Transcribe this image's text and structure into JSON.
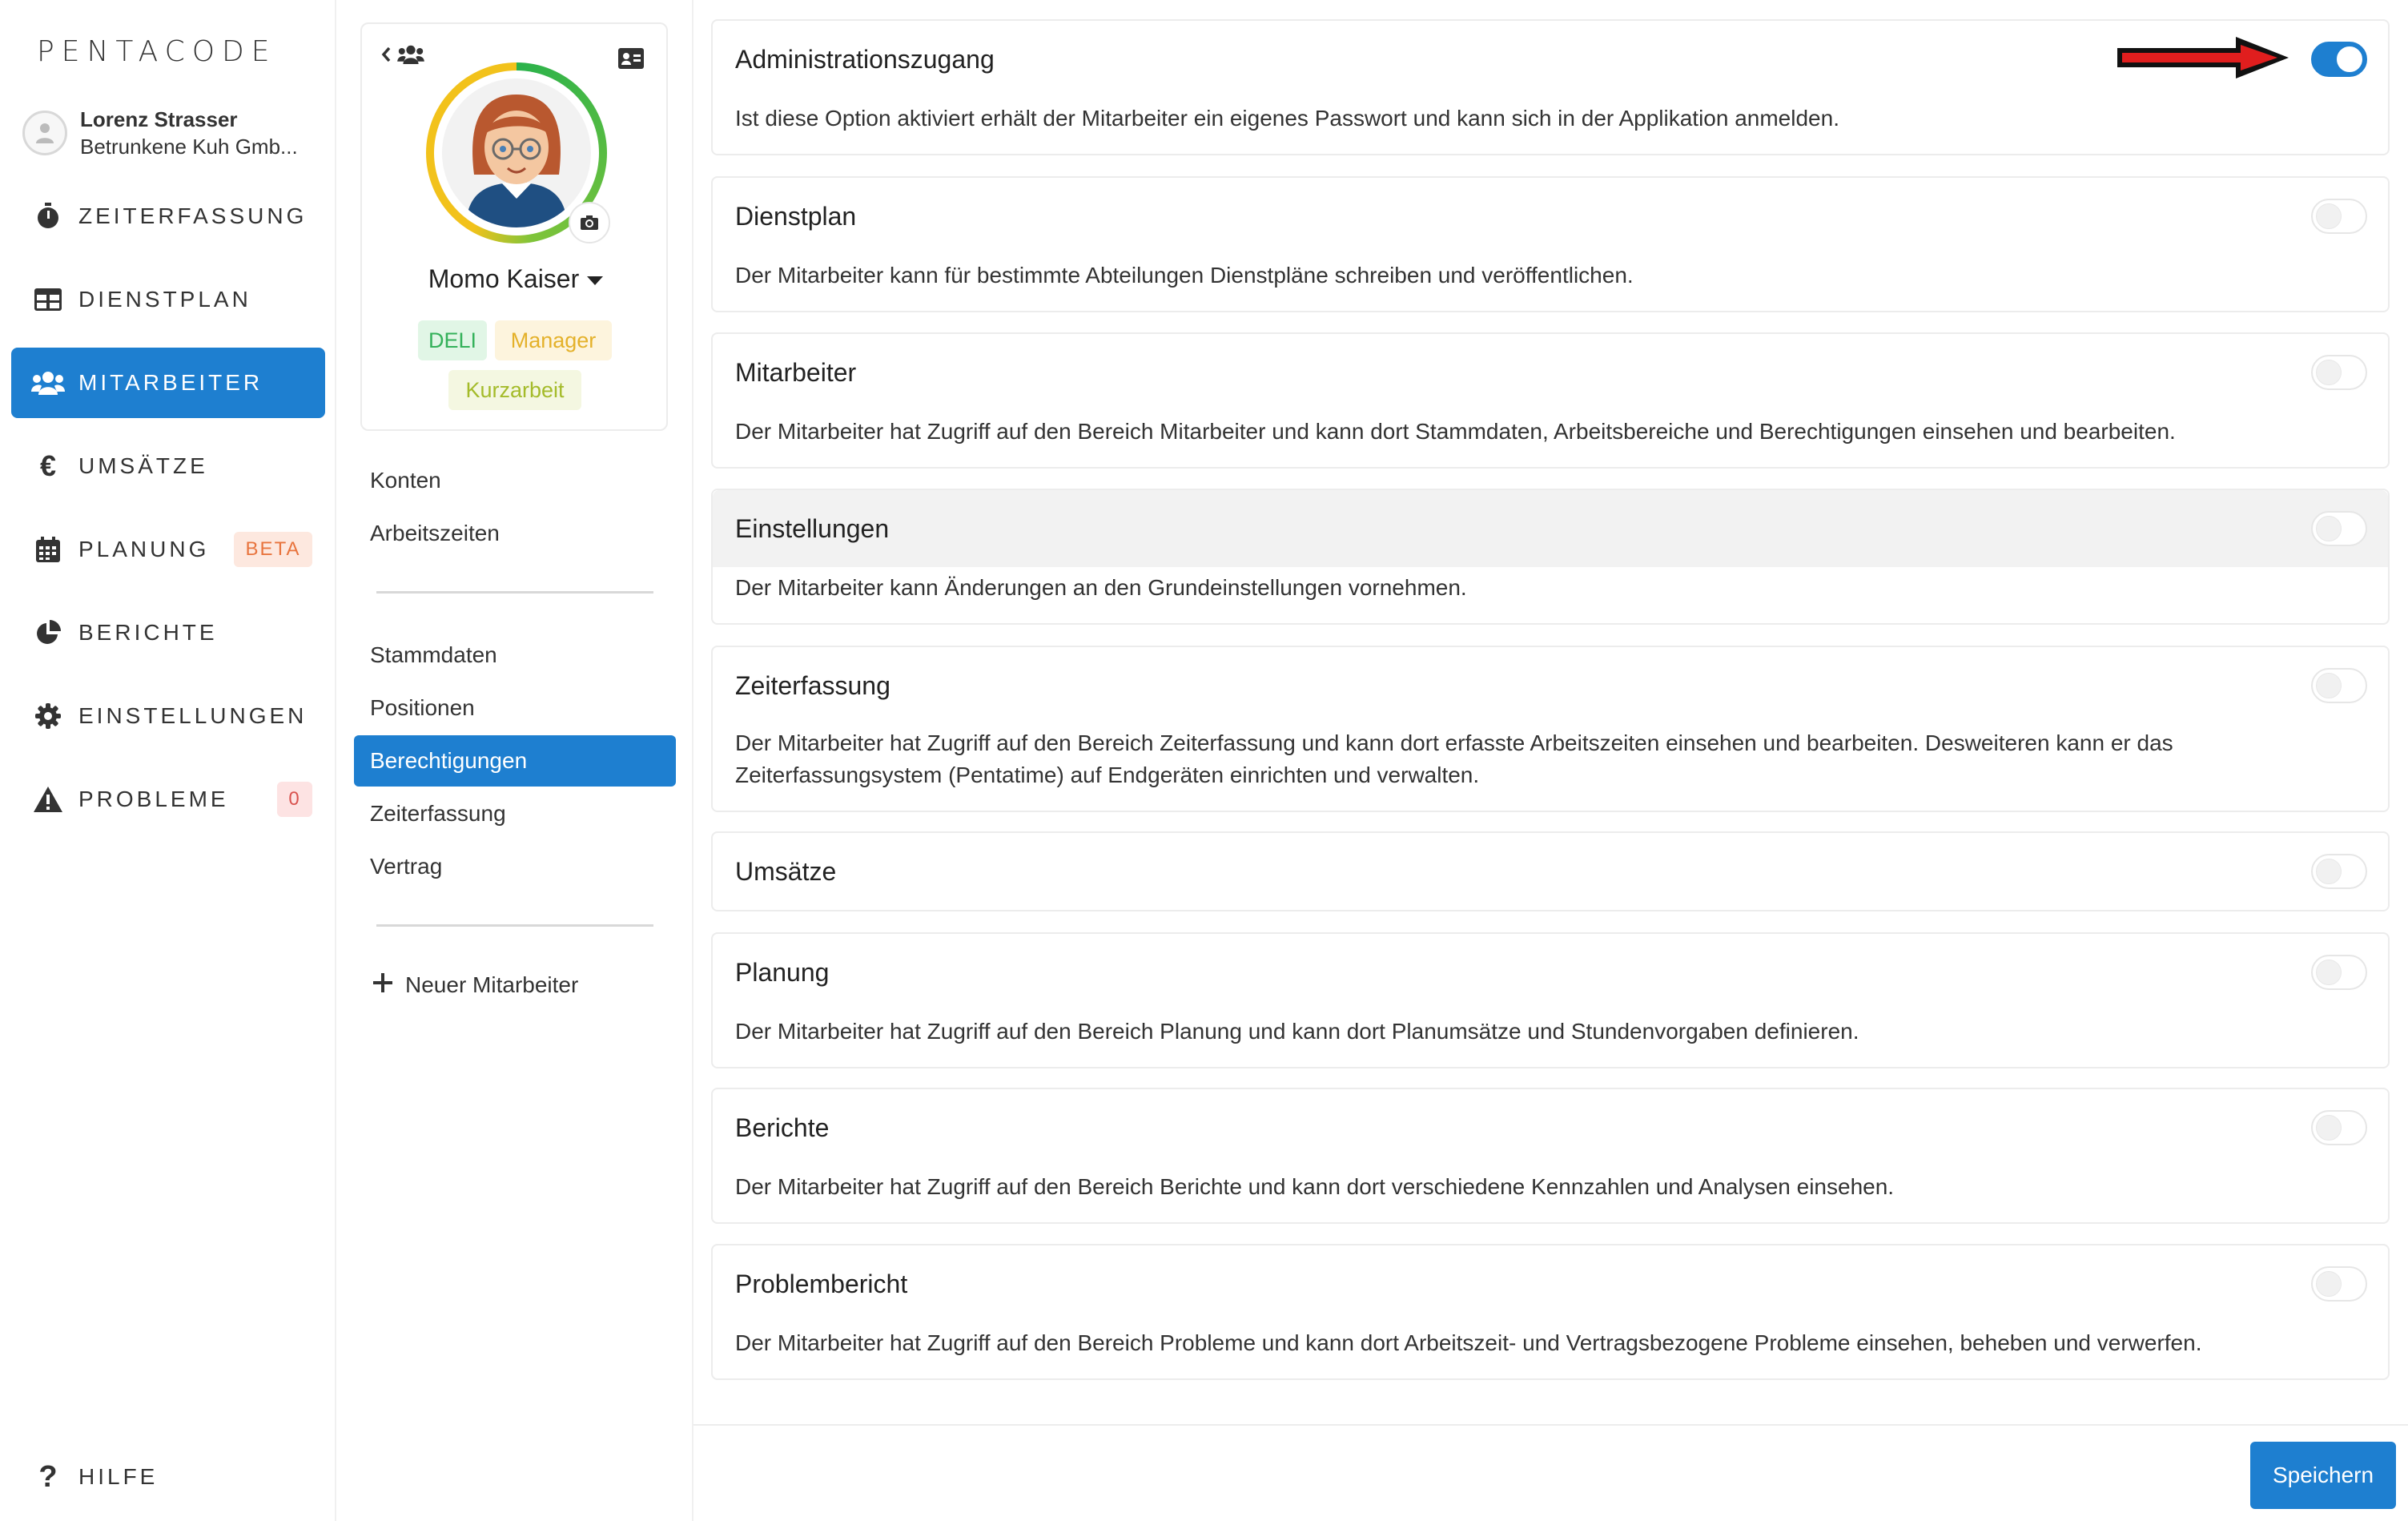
{
  "app": {
    "logo": "PENTACODE"
  },
  "user": {
    "name": "Lorenz Strasser",
    "company": "Betrunkene Kuh Gmb..."
  },
  "nav": {
    "items": [
      {
        "label": "ZEITERFASSUNG",
        "icon": "stopwatch-icon"
      },
      {
        "label": "DIENSTPLAN",
        "icon": "table-icon"
      },
      {
        "label": "MITARBEITER",
        "icon": "users-icon",
        "active": true
      },
      {
        "label": "UMSÄTZE",
        "icon": "euro-icon"
      },
      {
        "label": "PLANUNG",
        "icon": "calendar-icon",
        "badge": "BETA"
      },
      {
        "label": "BERICHTE",
        "icon": "pie-chart-icon"
      },
      {
        "label": "EINSTELLUNGEN",
        "icon": "gear-icon"
      },
      {
        "label": "PROBLEME",
        "icon": "warning-icon",
        "badge": "0"
      }
    ],
    "help": "HILFE"
  },
  "employee": {
    "name": "Momo Kaiser",
    "tags": [
      "DELI",
      "Manager",
      "Kurzarbeit"
    ]
  },
  "subnav": {
    "group1": [
      "Konten",
      "Arbeitszeiten"
    ],
    "group2": [
      "Stammdaten",
      "Positionen",
      "Berechtigungen",
      "Zeiterfassung",
      "Vertrag"
    ],
    "active": "Berechtigungen",
    "new_employee": "Neuer Mitarbeiter"
  },
  "permissions": [
    {
      "title": "Administrationszugang",
      "desc": "Ist diese Option aktiviert erhält der Mitarbeiter ein eigenes Passwort und kann sich in der Applikation anmelden.",
      "enabled": true
    },
    {
      "title": "Dienstplan",
      "desc": "Der Mitarbeiter kann für bestimmte Abteilungen Dienstpläne schreiben und veröffentlichen.",
      "enabled": false
    },
    {
      "title": "Mitarbeiter",
      "desc": "Der Mitarbeiter hat Zugriff auf den Bereich Mitarbeiter und kann dort Stammdaten, Arbeitsbereiche und Berechtigungen einsehen und bearbeiten.",
      "enabled": false
    },
    {
      "title": "Einstellungen",
      "desc": "Der Mitarbeiter kann Änderungen an den Grundeinstellungen vornehmen.",
      "enabled": false
    },
    {
      "title": "Zeiterfassung",
      "desc": "Der Mitarbeiter hat Zugriff auf den Bereich Zeiterfassung und kann dort erfasste Arbeitszeiten einsehen und bearbeiten. Desweiteren kann er das Zeiterfassungsystem (Pentatime) auf Endgeräten einrichten und verwalten.",
      "enabled": false
    },
    {
      "title": "Umsätze",
      "desc": "",
      "enabled": false
    },
    {
      "title": "Planung",
      "desc": "Der Mitarbeiter hat Zugriff auf den Bereich Planung und kann dort Planumsätze und Stundenvorgaben definieren.",
      "enabled": false
    },
    {
      "title": "Berichte",
      "desc": "Der Mitarbeiter hat Zugriff auf den Bereich Berichte und kann dort verschiedene Kennzahlen und Analysen einsehen.",
      "enabled": false
    },
    {
      "title": "Problembericht",
      "desc": "Der Mitarbeiter hat Zugriff auf den Bereich Probleme und kann dort Arbeitszeit- und Vertragsbezogene Probleme einsehen, beheben und verwerfen.",
      "enabled": false
    }
  ],
  "actions": {
    "save": "Speichern"
  },
  "colors": {
    "accent": "#1e7fd0",
    "beta": "#e8743e",
    "alert": "#d9534f",
    "arrow": "#e01e1e"
  }
}
